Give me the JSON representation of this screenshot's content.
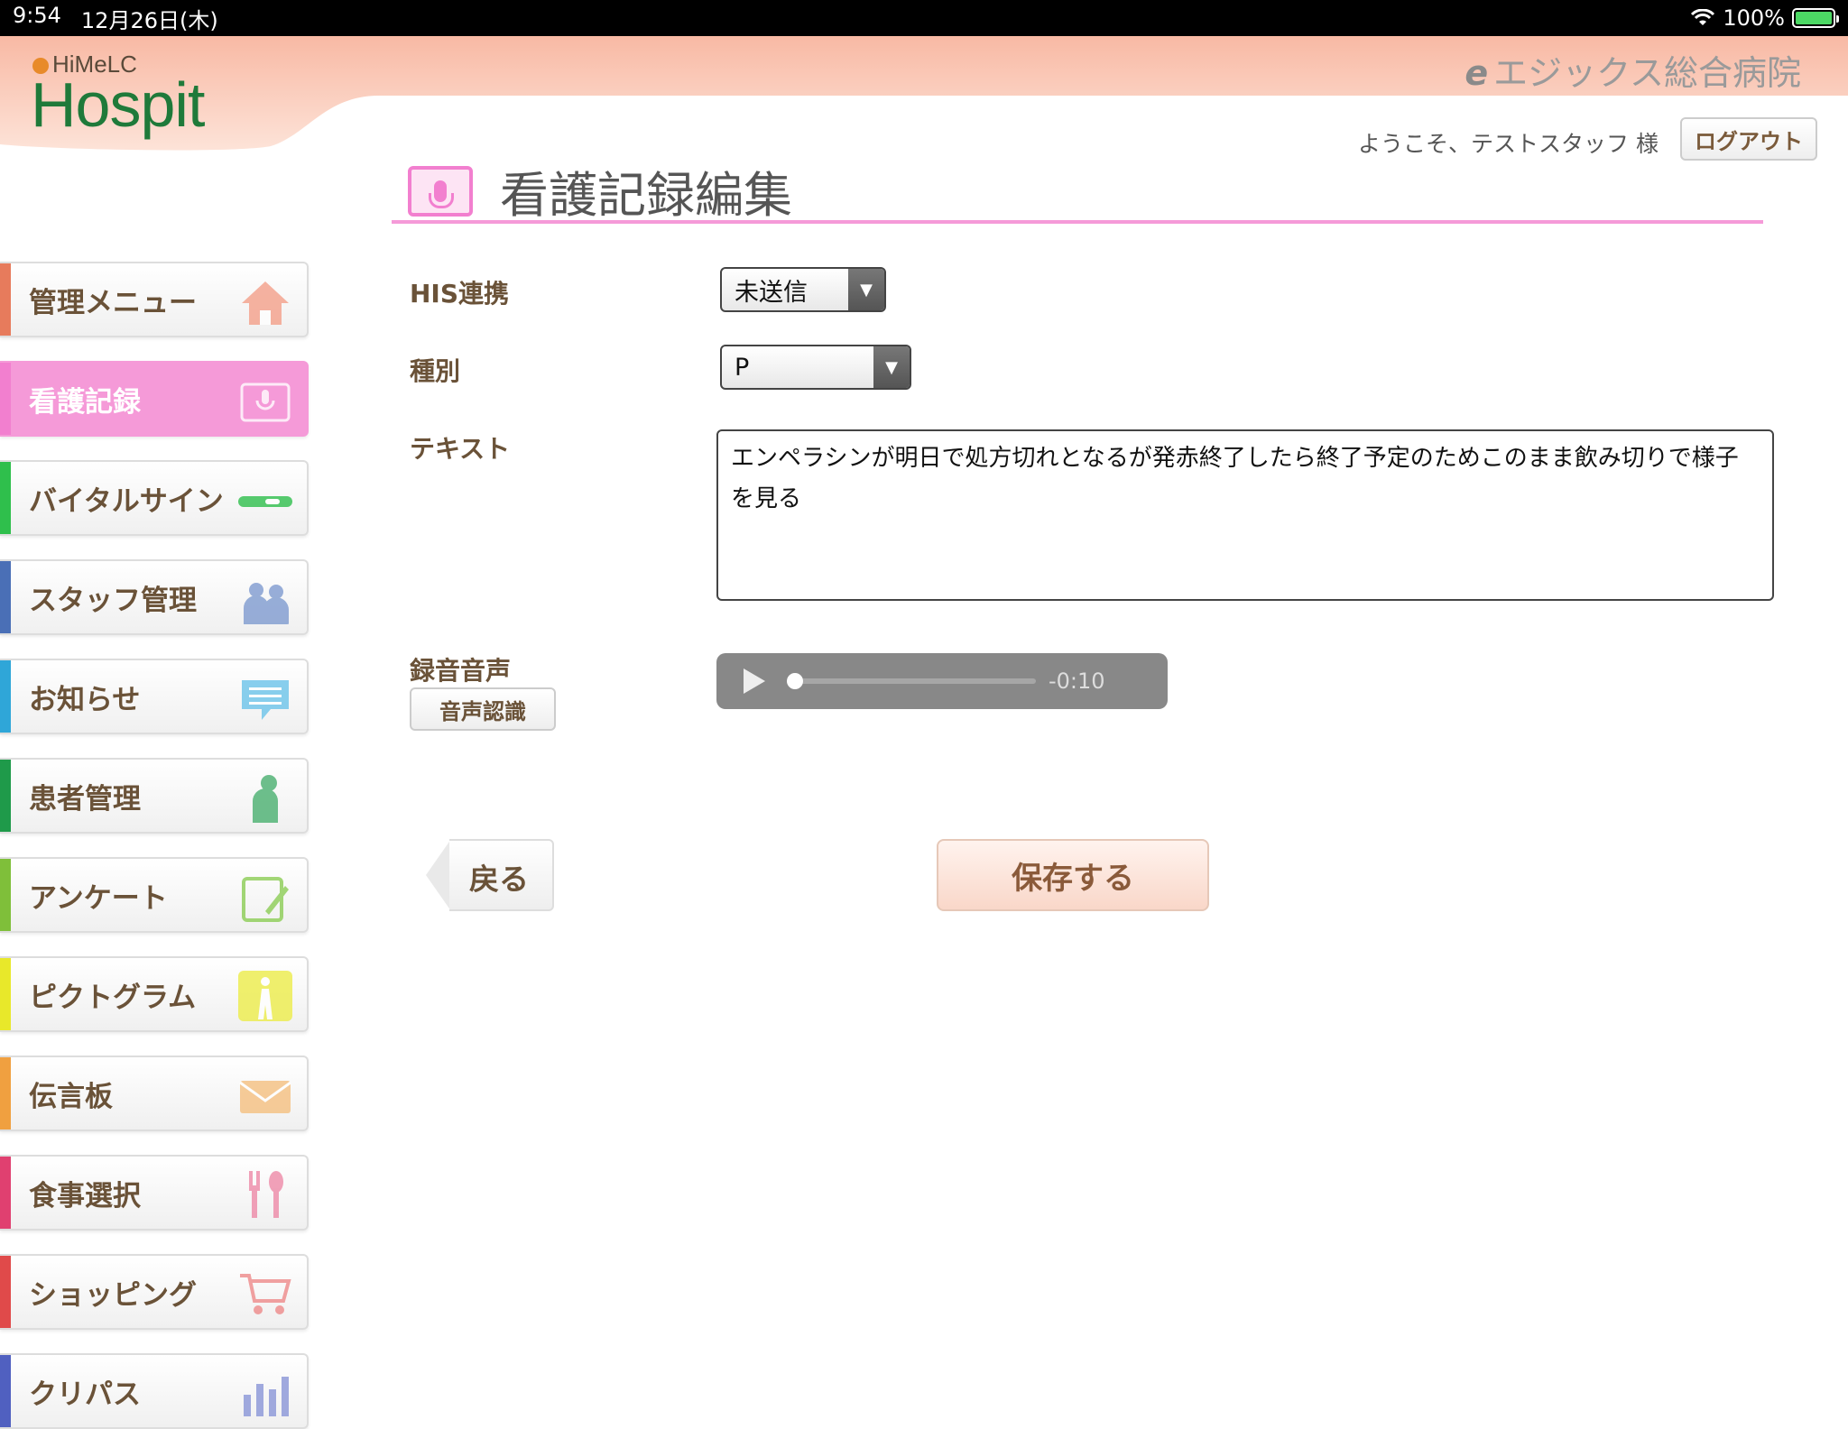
{
  "status_bar": {
    "time": "9:54",
    "date": "12月26日(木)",
    "battery": "100%"
  },
  "header": {
    "brand_small": "HiMeLC",
    "brand_big": "Hospit",
    "hospital_e": "e",
    "hospital_name": "エジックス総合病院",
    "welcome": "ようこそ、テストスタッフ 様",
    "logout": "ログアウト"
  },
  "page": {
    "title": "看護記録編集"
  },
  "sidebar": {
    "items": [
      {
        "label": "管理メニュー",
        "color": "#e77b5c",
        "icon": "home-icon"
      },
      {
        "label": "看護記録",
        "color": "#f27fcf",
        "icon": "mic-icon",
        "active": true
      },
      {
        "label": "バイタルサイン",
        "color": "#2fbf4c",
        "icon": "thermometer-icon"
      },
      {
        "label": "スタッフ管理",
        "color": "#4a6fb6",
        "icon": "staff-icon"
      },
      {
        "label": "お知らせ",
        "color": "#2fa6d8",
        "icon": "speech-bubble-icon"
      },
      {
        "label": "患者管理",
        "color": "#1f9a4a",
        "icon": "patient-icon"
      },
      {
        "label": "アンケート",
        "color": "#7fbf3a",
        "icon": "clipboard-icon"
      },
      {
        "label": "ピクトグラム",
        "color": "#e8e82a",
        "icon": "pictogram-icon"
      },
      {
        "label": "伝言板",
        "color": "#f0a040",
        "icon": "envelope-icon"
      },
      {
        "label": "食事選択",
        "color": "#e04070",
        "icon": "cutlery-icon"
      },
      {
        "label": "ショッピング",
        "color": "#e04a4a",
        "icon": "cart-icon"
      },
      {
        "label": "クリパス",
        "color": "#5060c0",
        "icon": "chart-icon"
      }
    ]
  },
  "form": {
    "his_label": "HIS連携",
    "his_value": "未送信",
    "type_label": "種別",
    "type_value": "P",
    "text_label": "テキスト",
    "text_value": "エンペラシンが明日で処方切れとなるが発赤終了したら終了予定のためこのまま飲み切りで様子を見る",
    "audio_label": "録音音声",
    "speech_button": "音声認識",
    "audio_time": "-0:10",
    "audio_progress": 0
  },
  "actions": {
    "back": "戻る",
    "save": "保存する"
  }
}
